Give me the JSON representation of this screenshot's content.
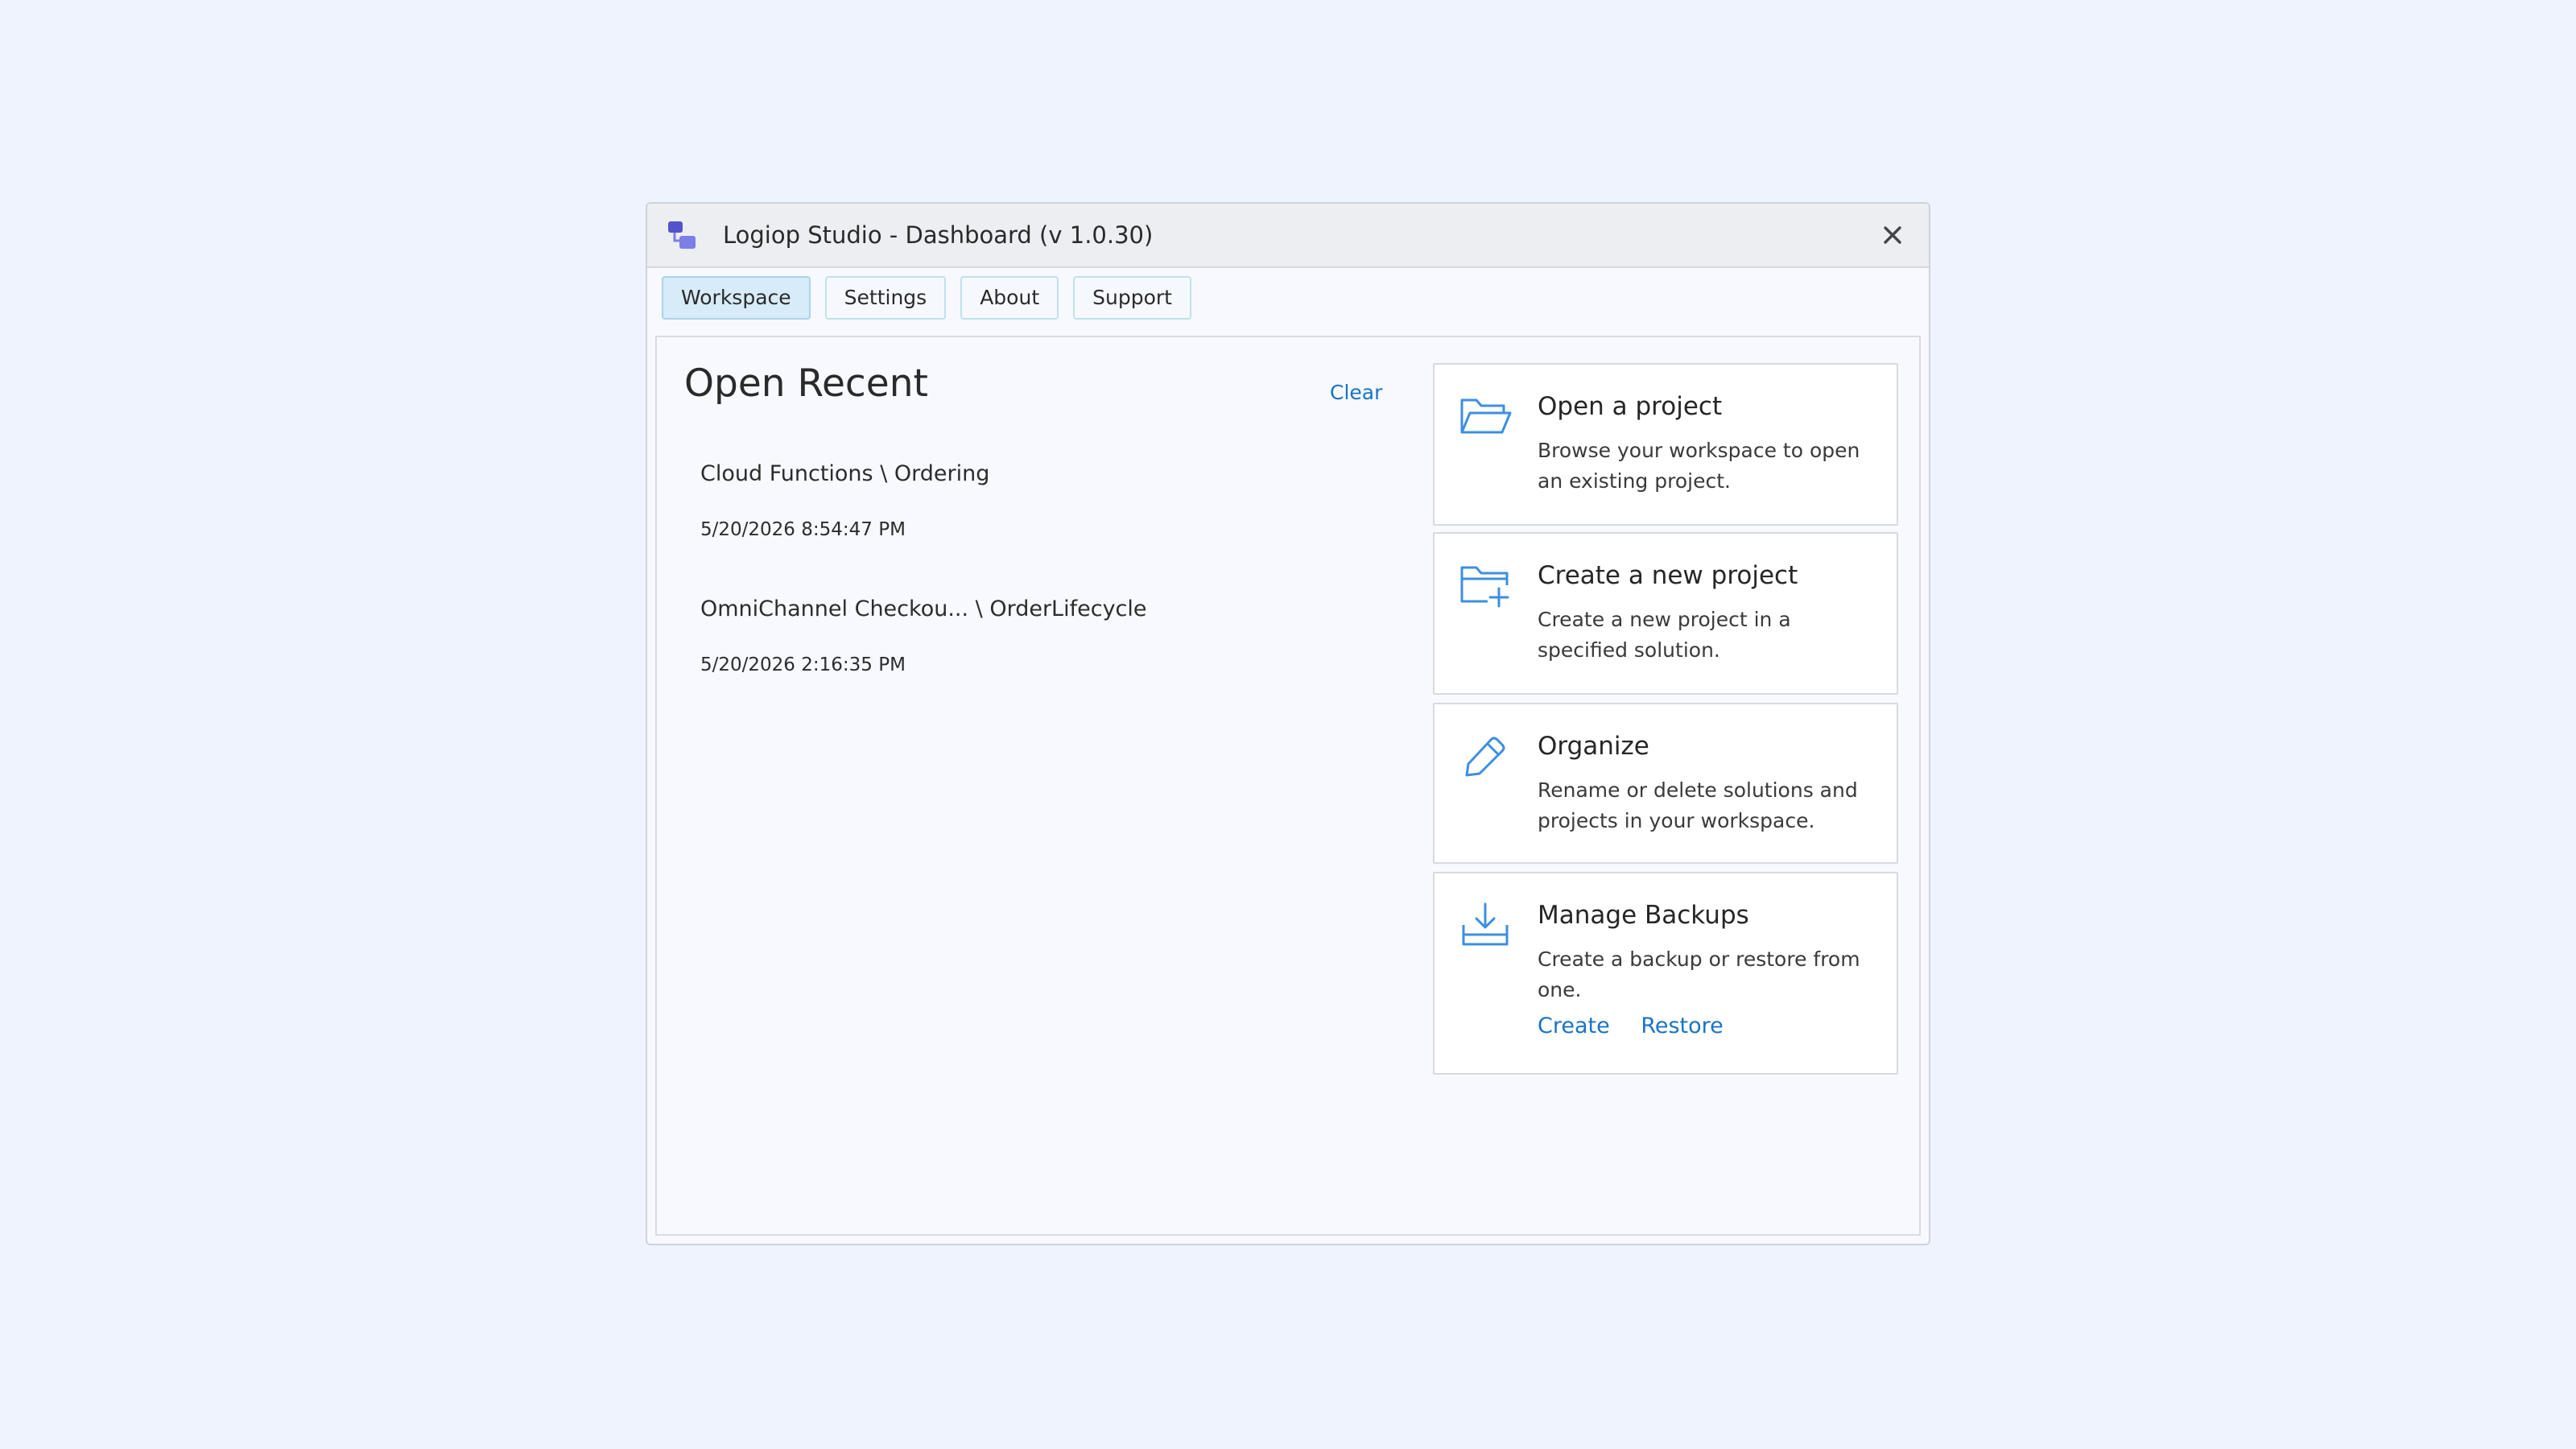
{
  "window": {
    "title": "Logiop Studio - Dashboard (v 1.0.30)",
    "app_icon": "app-logo-icon",
    "close_icon": "close-icon"
  },
  "tabs": [
    {
      "label": "Workspace",
      "active": true
    },
    {
      "label": "Settings",
      "active": false
    },
    {
      "label": "About",
      "active": false
    },
    {
      "label": "Support",
      "active": false
    }
  ],
  "recent": {
    "title": "Open Recent",
    "clear_label": "Clear",
    "items": [
      {
        "name": "Cloud Functions \\ Ordering",
        "date": "5/20/2026 8:54:47 PM"
      },
      {
        "name": "OmniChannel Checkou...  \\ OrderLifecycle",
        "date": "5/20/2026 2:16:35 PM"
      }
    ]
  },
  "cards": [
    {
      "icon": "folder-open-icon",
      "title": "Open a project",
      "description": "Browse your workspace to open an existing project."
    },
    {
      "icon": "folder-add-icon",
      "title": "Create a new project",
      "description": "Create a new project in a specified solution."
    },
    {
      "icon": "pencil-icon",
      "title": "Organize",
      "description": "Rename or delete solutions and projects in your workspace."
    },
    {
      "icon": "download-tray-icon",
      "title": "Manage Backups",
      "description": "Create a backup or restore from one.",
      "links": [
        "Create",
        "Restore"
      ]
    }
  ],
  "colors": {
    "accent": "#1a73c6",
    "icon_blue": "#3d8fe0",
    "background": "#eff3fe",
    "logo_primary": "#5b5fd8"
  }
}
